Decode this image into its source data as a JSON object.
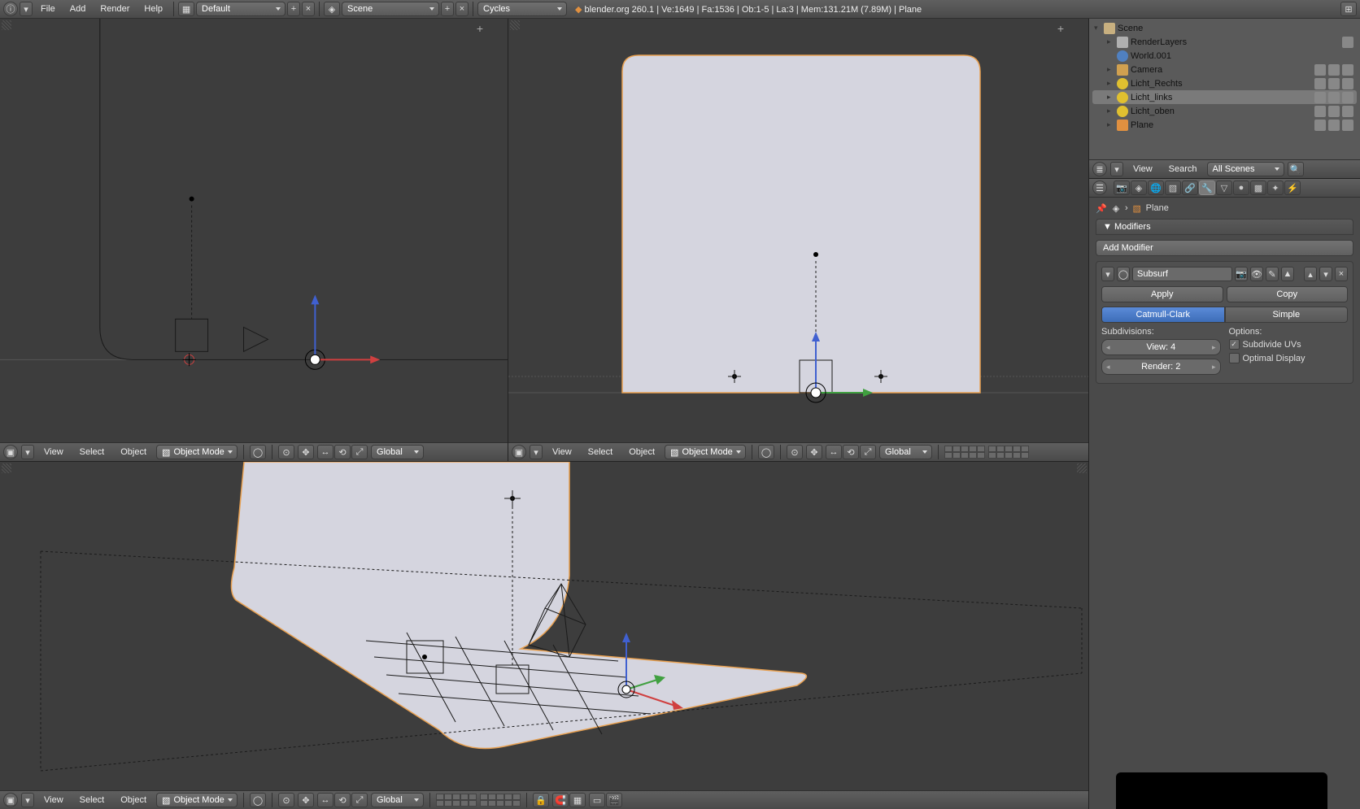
{
  "top": {
    "menus": [
      "File",
      "Add",
      "Render",
      "Help"
    ],
    "layout": "Default",
    "scene": "Scene",
    "engine": "Cycles",
    "status": "blender.org 260.1 | Ve:1649 | Fa:1536 | Ob:1-5 | La:3 | Mem:131.21M (7.89M) | Plane"
  },
  "outliner": {
    "scene": "Scene",
    "render_layers": "RenderLayers",
    "world": "World.001",
    "items": [
      {
        "name": "Camera",
        "icon": "camera"
      },
      {
        "name": "Licht_Rechts",
        "icon": "lamp"
      },
      {
        "name": "Licht_links",
        "icon": "lamp",
        "sel": true
      },
      {
        "name": "Licht_oben",
        "icon": "lamp"
      },
      {
        "name": "Plane",
        "icon": "mesh"
      }
    ],
    "menus": [
      "View",
      "Search"
    ],
    "filter": "All Scenes"
  },
  "props": {
    "context_object": "Plane",
    "modifiers_title": "Modifiers",
    "add_modifier": "Add Modifier",
    "mod": {
      "name": "Subsurf",
      "apply": "Apply",
      "copy": "Copy",
      "type_a": "Catmull-Clark",
      "type_b": "Simple",
      "subdiv_label": "Subdivisions:",
      "view": "View: 4",
      "render": "Render: 2",
      "options_label": "Options:",
      "subdivide_uvs": "Subdivide UVs",
      "optimal": "Optimal Display"
    }
  },
  "vp_header": {
    "menus": [
      "View",
      "Select",
      "Object"
    ],
    "mode": "Object Mode",
    "orientation": "Global"
  }
}
